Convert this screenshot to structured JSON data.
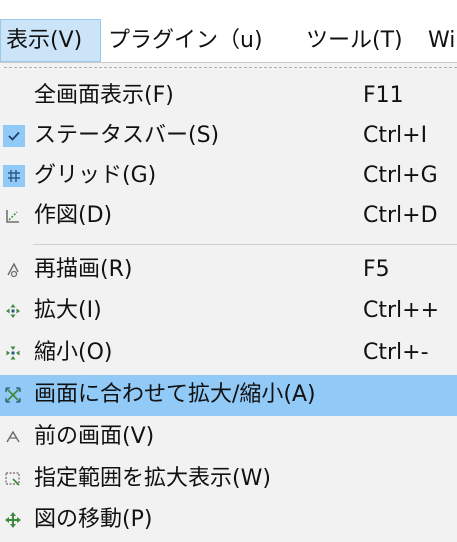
{
  "menubar": {
    "items": [
      {
        "label": "表示(V)",
        "active": true
      },
      {
        "label": "プラグイン（u)"
      },
      {
        "label": "ツール(T)"
      },
      {
        "label": "Wi"
      }
    ]
  },
  "menu": {
    "items": [
      {
        "label": "全画面表示(F)",
        "shortcut": "F11",
        "icon": "none"
      },
      {
        "label": "ステータスバー(S)",
        "shortcut": "Ctrl+I",
        "icon": "checkmark-icon",
        "checked": true
      },
      {
        "label": "グリッド(G)",
        "shortcut": "Ctrl+G",
        "icon": "grid-icon",
        "checked": true
      },
      {
        "label": "作図(D)",
        "shortcut": "Ctrl+D",
        "icon": "drawing-icon"
      },
      {
        "label": "再描画(R)",
        "shortcut": "F5",
        "icon": "redraw-icon"
      },
      {
        "label": "拡大(I)",
        "shortcut": "Ctrl++",
        "icon": "zoom-in-icon"
      },
      {
        "label": "縮小(O)",
        "shortcut": "Ctrl+-",
        "icon": "zoom-out-icon"
      },
      {
        "label": "画面に合わせて拡大/縮小(A)",
        "shortcut": "",
        "icon": "fit-to-screen-icon",
        "highlighted": true
      },
      {
        "label": "前の画面(V)",
        "shortcut": "",
        "icon": "previous-view-icon"
      },
      {
        "label": "指定範囲を拡大表示(W)",
        "shortcut": "",
        "icon": "zoom-area-icon"
      },
      {
        "label": "図の移動(P)",
        "shortcut": "",
        "icon": "move-drawing-icon"
      }
    ]
  },
  "colors": {
    "menu_background": "#f2f2f2",
    "highlight": "#91c9f7",
    "menubar_active": "#cce4f7",
    "icon_green": "#3c8a3c",
    "icon_gray": "#6a6a6a"
  }
}
